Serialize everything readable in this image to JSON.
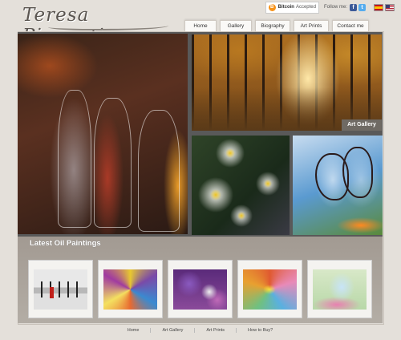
{
  "site": {
    "title": "Teresa Piacentino"
  },
  "topbar": {
    "bitcoin_brand": "Bitcoin",
    "bitcoin_text": "Accepted",
    "follow_label": "Follow me:"
  },
  "nav": [
    {
      "label": "Home"
    },
    {
      "label": "Gallery"
    },
    {
      "label": "Biography"
    },
    {
      "label": "Art Prints"
    },
    {
      "label": "Contact me"
    }
  ],
  "hero": {
    "gallery_label": "Art Gallery"
  },
  "latest": {
    "title": "Latest Oil Paintings",
    "thumbnails": [
      {
        "name": "cityscape-painting"
      },
      {
        "name": "abstract-flower-painting"
      },
      {
        "name": "purple-orchid-painting"
      },
      {
        "name": "colorful-flower-painting"
      },
      {
        "name": "butterfly-painting"
      }
    ]
  },
  "footer": [
    {
      "label": "Home"
    },
    {
      "label": "Art Gallery"
    },
    {
      "label": "Art Prints"
    },
    {
      "label": "How to Buy?"
    }
  ],
  "colors": {
    "background": "#e4e0da",
    "hero_frame": "#595959",
    "thumb_band": "#a29a92",
    "bitcoin": "#f7931a",
    "facebook": "#3b5998",
    "twitter": "#55acee"
  }
}
